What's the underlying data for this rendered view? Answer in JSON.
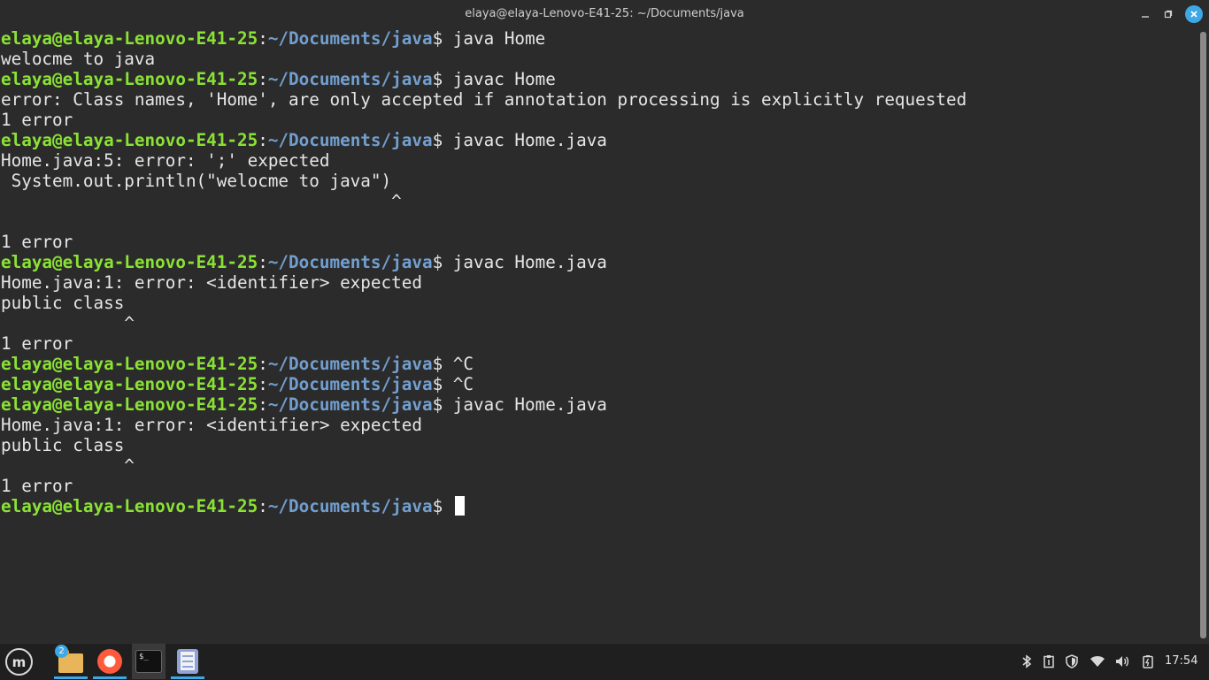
{
  "window": {
    "title": "elaya@elaya-Lenovo-E41-25: ~/Documents/java"
  },
  "prompt": {
    "user_host": "elaya@elaya-Lenovo-E41-25",
    "colon": ":",
    "path": "~/Documents/java",
    "dollar": "$ "
  },
  "terminal": {
    "lines": [
      {
        "type": "prompt",
        "cmd": "java Home"
      },
      {
        "type": "out",
        "text": "welocme to java"
      },
      {
        "type": "prompt",
        "cmd": "javac Home"
      },
      {
        "type": "out",
        "text": "error: Class names, 'Home', are only accepted if annotation processing is explicitly requested"
      },
      {
        "type": "out",
        "text": "1 error"
      },
      {
        "type": "prompt",
        "cmd": "javac Home.java"
      },
      {
        "type": "out",
        "text": "Home.java:5: error: ';' expected"
      },
      {
        "type": "out",
        "text": " System.out.println(\"welocme to java\")"
      },
      {
        "type": "out",
        "text": "                                      ^"
      },
      {
        "type": "out",
        "text": ""
      },
      {
        "type": "out",
        "text": "1 error"
      },
      {
        "type": "prompt",
        "cmd": "javac Home.java"
      },
      {
        "type": "out",
        "text": "Home.java:1: error: <identifier> expected"
      },
      {
        "type": "out",
        "text": "public class"
      },
      {
        "type": "out",
        "text": "            ^"
      },
      {
        "type": "out",
        "text": "1 error"
      },
      {
        "type": "prompt",
        "cmd": "^C"
      },
      {
        "type": "prompt",
        "cmd": "^C"
      },
      {
        "type": "prompt",
        "cmd": "javac Home.java"
      },
      {
        "type": "out",
        "text": "Home.java:1: error: <identifier> expected"
      },
      {
        "type": "out",
        "text": "public class"
      },
      {
        "type": "out",
        "text": "            ^"
      },
      {
        "type": "out",
        "text": "1 error"
      },
      {
        "type": "prompt",
        "cmd": "",
        "cursor": true
      }
    ]
  },
  "taskbar": {
    "menu_label": "m",
    "files_badge": "2",
    "terminal_icon_text": "$_",
    "clock": "17:54"
  },
  "colors": {
    "background": "#2b2b2b",
    "prompt_user": "#8ae234",
    "prompt_path": "#729fcf",
    "accent": "#3da8e6"
  },
  "icons": [
    "minimize-icon",
    "maximize-icon",
    "close-icon",
    "mint-menu-icon",
    "folder-icon",
    "firefox-icon",
    "terminal-icon",
    "text-editor-icon",
    "bluetooth-icon",
    "clipboard-icon",
    "shield-icon",
    "wifi-icon",
    "volume-icon",
    "battery-icon"
  ]
}
